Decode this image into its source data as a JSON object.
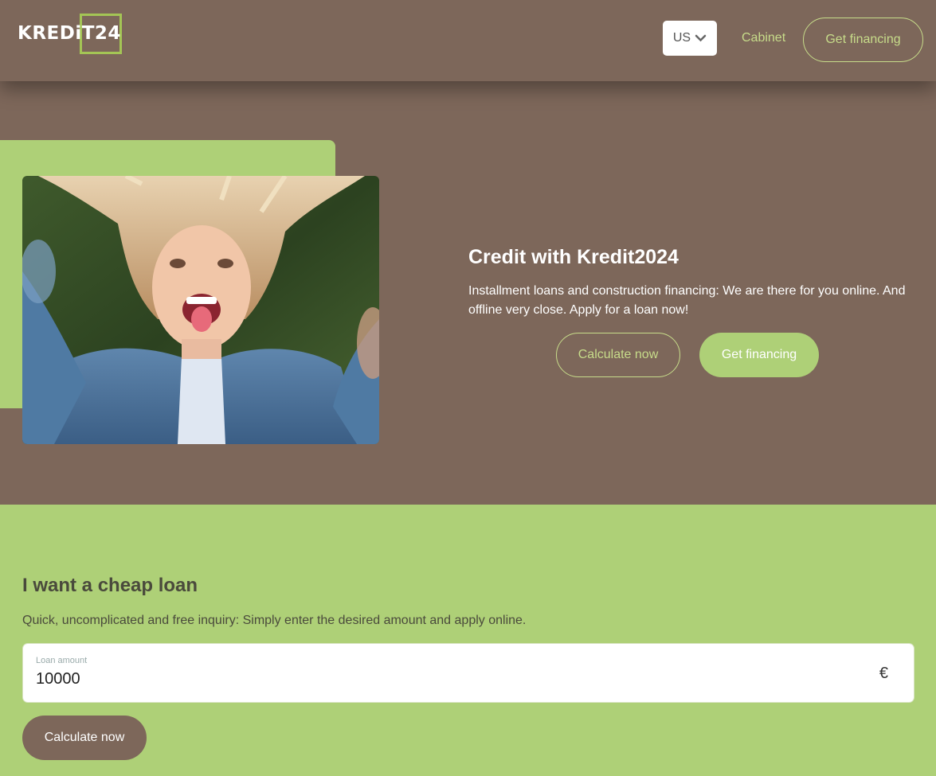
{
  "header": {
    "logo_text": "KREDiT24",
    "language": "US",
    "cabinet_label": "Cabinet",
    "financing_label": "Get financing"
  },
  "hero": {
    "title": "Credit with Kredit2024",
    "description": "Installment loans and construction financing: We are there for you online. And offline very close. Apply for a loan now!",
    "calculate_label": "Calculate now",
    "financing_label": "Get financing"
  },
  "loan": {
    "title": "I want a cheap loan",
    "description": "Quick, uncomplicated and free inquiry: Simply enter the desired amount and apply online.",
    "field_label": "Loan amount",
    "amount": "10000",
    "currency": "€",
    "button_label": "Calculate now"
  },
  "colors": {
    "brown": "#7d675a",
    "green": "#aed077",
    "light_green_text": "#c7dc8a"
  },
  "icons": {
    "language_dropdown": "chevron-down-icon"
  }
}
